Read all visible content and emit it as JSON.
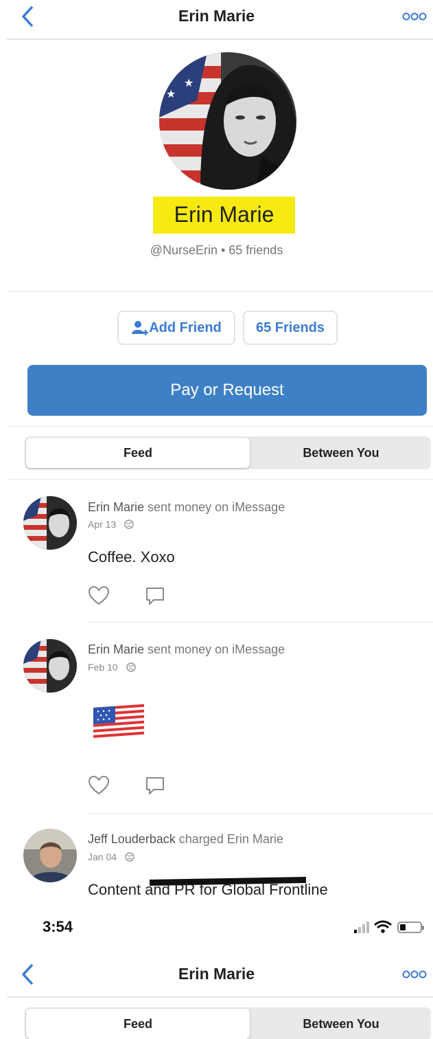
{
  "header": {
    "title": "Erin Marie"
  },
  "profile": {
    "name": "Erin Marie",
    "subtitle": "@NurseErin • 65 friends"
  },
  "actions": {
    "add_friend": "Add Friend",
    "friends": "65 Friends",
    "pay": "Pay or Request"
  },
  "tabs": [
    "Feed",
    "Between You"
  ],
  "feed": [
    {
      "name": "Erin Marie",
      "action": "sent money on iMessage",
      "date": "Apr 13",
      "message": "Coffee. Xoxo"
    },
    {
      "name": "Erin Marie",
      "action": "sent money on iMessage",
      "date": "Feb 10",
      "emoji": "🇺🇸"
    },
    {
      "name": "Jeff Louderback",
      "action": "charged Erin Marie",
      "date": "Jan 04",
      "message": "Content and PR for Global Frontline"
    }
  ],
  "status_bar": {
    "time": "3:54"
  },
  "colors": {
    "accent": "#3d80c6",
    "highlight": "#f7ea10"
  },
  "icons": [
    "chevron-left-icon",
    "more-dots-icon",
    "add-friend-icon",
    "heart-icon",
    "comment-icon",
    "globe-icon",
    "signal-icon",
    "wifi-icon",
    "battery-icon"
  ]
}
